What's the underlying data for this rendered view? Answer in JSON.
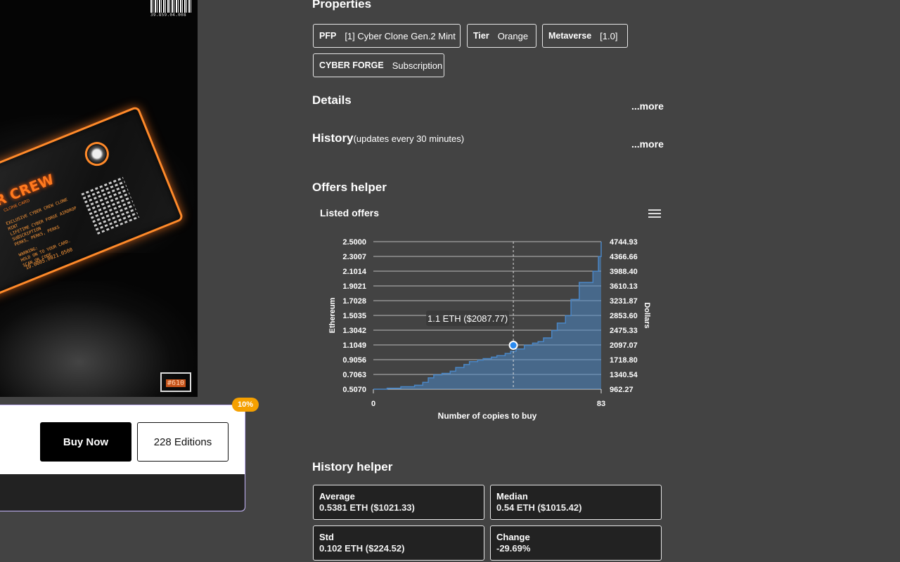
{
  "artwork": {
    "barcode_number": "39.859.04.008",
    "card_title": "R CREW",
    "card_subtitle": "CLONE CARD",
    "card_text": "EXCLUSIVE CYBER CREW CLONE MINT\nLIFETIME CYBER FORGE AIRDROP SUBSCRIPTION\nPERKS, PERKS, PERKS\n\nWARNING:\nHOLD ON TO YOUR CARD.\nSCAN QR CODE",
    "card_serial": "10.0005.0021.0500",
    "edition_tag": "#610"
  },
  "buy_panel": {
    "buy_now_label": "Buy Now",
    "editions_label": "228 Editions",
    "discount_badge": "10%"
  },
  "properties": {
    "title": "Properties",
    "items": [
      {
        "key": "PFP",
        "value": "[1] Cyber Clone Gen.2 Mint"
      },
      {
        "key": "Tier",
        "value": "Orange"
      },
      {
        "key": "Metaverse",
        "value": "[1.0]"
      },
      {
        "key": "CYBER FORGE",
        "value": "Subscription"
      }
    ]
  },
  "details": {
    "title": "Details",
    "more_label": "...more"
  },
  "history": {
    "title": "History",
    "note": "(updates every 30 minutes)",
    "more_label": "...more"
  },
  "offers_helper": {
    "title": "Offers helper",
    "chart_title": "Listed offers",
    "tooltip": "1.1 ETH ($2087.77)"
  },
  "chart_data": {
    "type": "area",
    "title": "Listed offers",
    "xlabel": "Number of copies to buy",
    "ylabel": "Ethereum",
    "ylabel_right": "Dollars",
    "xlim": [
      0,
      83
    ],
    "x_ticks": [
      "0",
      "83"
    ],
    "y_ticks": [
      "0.5070",
      "0.7063",
      "0.9056",
      "1.1049",
      "1.3042",
      "1.5035",
      "1.7028",
      "1.9021",
      "2.1014",
      "2.3007",
      "2.5000"
    ],
    "y_ticks_right": [
      "962.27",
      "1340.54",
      "1718.80",
      "2097.07",
      "2475.33",
      "2853.60",
      "3231.87",
      "3610.13",
      "3988.40",
      "4366.66",
      "4744.93"
    ],
    "ylim": [
      0.507,
      2.5
    ],
    "series": [
      {
        "x": [
          0,
          5,
          10,
          15,
          18,
          20,
          22,
          25,
          28,
          30,
          33,
          35,
          38,
          40,
          43,
          45,
          48,
          50,
          52,
          55,
          57,
          58,
          60,
          62,
          65,
          67,
          70,
          72,
          75,
          77,
          80,
          82,
          83
        ],
        "values": [
          0.507,
          0.52,
          0.54,
          0.56,
          0.6,
          0.66,
          0.7,
          0.72,
          0.75,
          0.8,
          0.84,
          0.88,
          0.9,
          0.92,
          0.94,
          0.96,
          0.99,
          1.02,
          1.05,
          1.1,
          1.1,
          1.13,
          1.15,
          1.2,
          1.3,
          1.4,
          1.5,
          1.72,
          1.95,
          1.95,
          2.1,
          2.3,
          2.5
        ]
      }
    ],
    "highlight": {
      "x": 51,
      "y": 1.1
    },
    "grid": true
  },
  "history_helper": {
    "title": "History helper",
    "stats": [
      {
        "label": "Average",
        "value": "0.5381 ETH ($1021.33)"
      },
      {
        "label": "Median",
        "value": "0.54 ETH ($1015.42)"
      },
      {
        "label": "Std",
        "value": "0.102 ETH ($224.52)"
      },
      {
        "label": "Change",
        "value": "-29.69%"
      }
    ]
  },
  "colors": {
    "background": "#434343",
    "accent": "#4a86c5",
    "badge": "#f5a000",
    "card_glow": "#ff8a2a"
  }
}
